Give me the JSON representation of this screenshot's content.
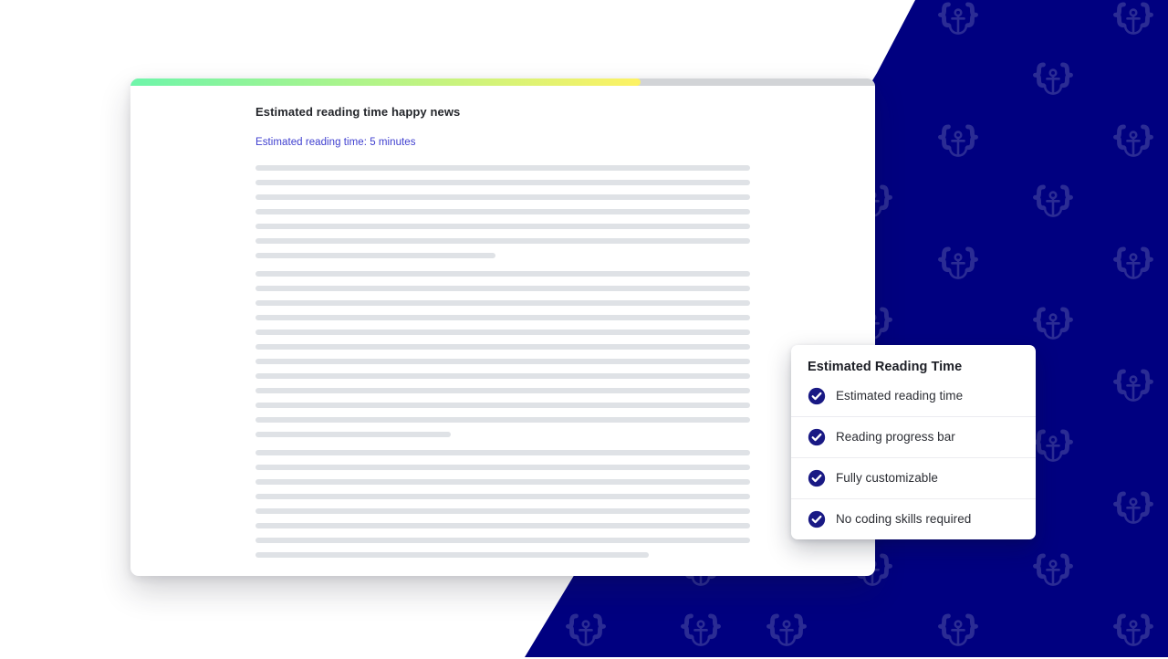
{
  "colors": {
    "backdrop_navy": "#000080",
    "pattern_icon": "#8f93c4",
    "progress_start": "#6ef5aa",
    "progress_end": "#fdf264",
    "progress_track": "#d2d4d7",
    "accent_link": "#3e3ecf",
    "check_badge": "#191984",
    "skeleton_line": "#dfe2e6"
  },
  "backdrop": {
    "pattern_icon_name": "anchor-in-braces-icon",
    "pattern_icon_count": 22
  },
  "document_preview": {
    "reading_progress_bar": {
      "name": "reading-progress-bar",
      "percent": 68.5
    },
    "title": "Estimated reading time happy news",
    "reading_time_label": "Estimated reading time: 5 minutes",
    "skeleton_paragraphs": [
      [
        100,
        100,
        100,
        100,
        100,
        100,
        48.5
      ],
      [
        100,
        100,
        100,
        100,
        100,
        100,
        100,
        100,
        100,
        100,
        100,
        39.5
      ],
      [
        100,
        100,
        100,
        100,
        100,
        100,
        100,
        79.5
      ]
    ]
  },
  "feature_card": {
    "title": "Estimated Reading Time",
    "items": [
      {
        "label": "Estimated reading time",
        "icon": "check-circle-icon"
      },
      {
        "label": "Reading progress bar",
        "icon": "check-circle-icon"
      },
      {
        "label": "Fully customizable",
        "icon": "check-circle-icon"
      },
      {
        "label": "No coding skills required",
        "icon": "check-circle-icon"
      }
    ]
  }
}
